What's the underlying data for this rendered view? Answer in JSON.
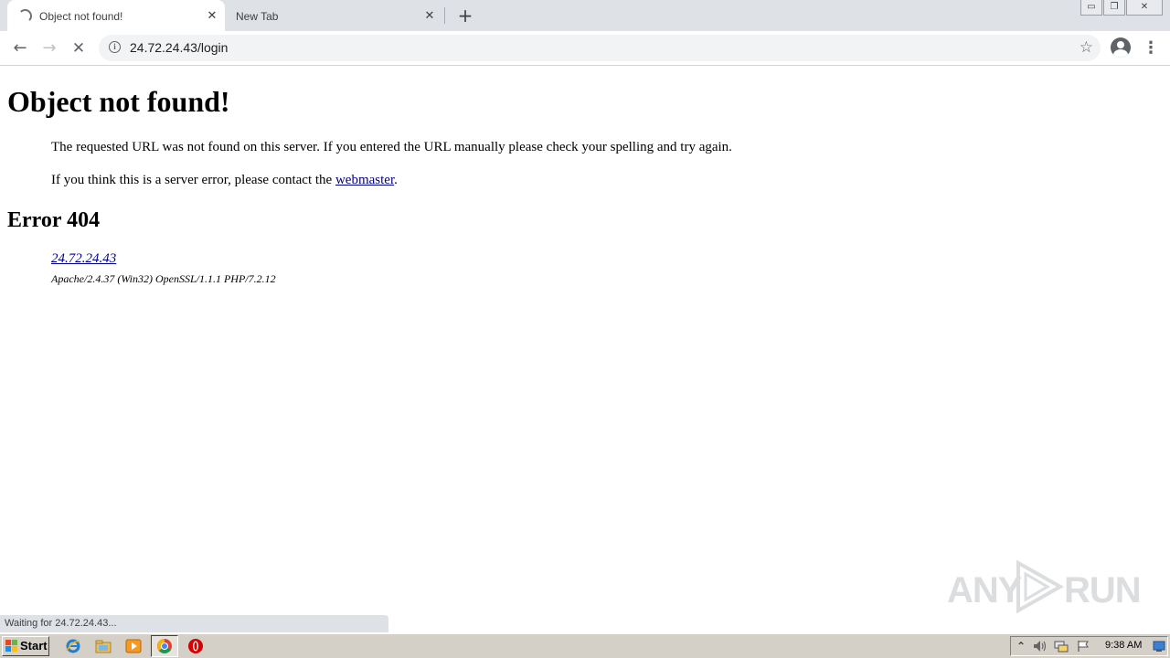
{
  "browser": {
    "tabs": [
      {
        "title": "Object not found!",
        "active": true
      },
      {
        "title": "New Tab",
        "active": false
      }
    ],
    "new_tab_glyph": "+",
    "close_glyph": "✕",
    "url": "24.72.24.43/login",
    "window_controls": {
      "minimize": "▭",
      "restore": "❐",
      "close": "✕"
    },
    "icons": {
      "back": "←",
      "forward": "→",
      "stop": "✕",
      "info": "i",
      "bookmark_star": "☆",
      "menu": "⋮"
    }
  },
  "page": {
    "heading": "Object not found!",
    "paragraph1": "The requested URL was not found on this server. If you entered the URL manually please check your spelling and try again.",
    "paragraph2_before": "If you think this is a server error, please contact the ",
    "paragraph2_link": "webmaster",
    "paragraph2_after": ".",
    "error_heading": "Error 404",
    "address_link": "24.72.24.43",
    "server_signature": "Apache/2.4.37 (Win32) OpenSSL/1.1.1 PHP/7.2.12"
  },
  "watermark": {
    "left": "ANY",
    "right": "RUN"
  },
  "status_bar": {
    "text": "Waiting for 24.72.24.43..."
  },
  "taskbar": {
    "start_label": "Start",
    "clock": "9:38 AM",
    "tray_expand": "⌃"
  },
  "colors": {
    "link": "#00008b",
    "tabstrip": "#dee1e6",
    "taskbar": "#d4d0c8"
  }
}
